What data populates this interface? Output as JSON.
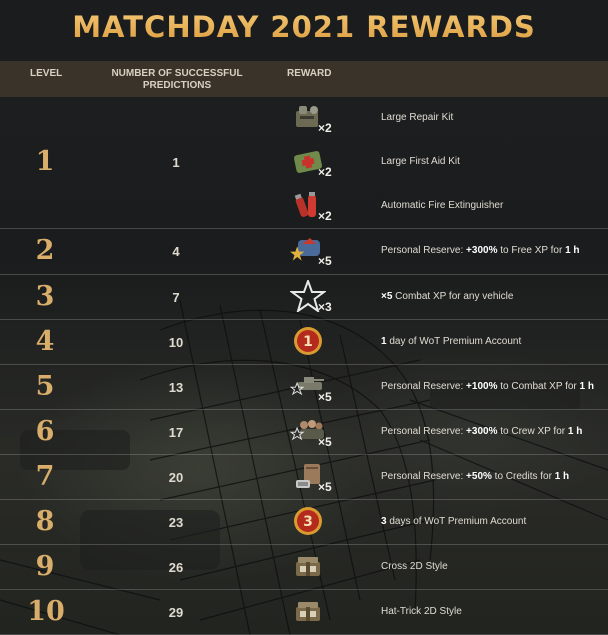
{
  "title": "MATCHDAY 2021 REWARDS",
  "headers": {
    "level": "LEVEL",
    "predictions": "NUMBER OF SUCCESSFUL PREDICTIONS",
    "reward": "REWARD"
  },
  "rows": [
    {
      "level": "1",
      "predictions": "1",
      "items": [
        {
          "icon": "repair-kit-icon",
          "multiplier": "×2",
          "text": [
            [
              "Large Repair Kit",
              false
            ]
          ]
        },
        {
          "icon": "first-aid-kit-icon",
          "multiplier": "×2",
          "text": [
            [
              "Large First Aid Kit",
              false
            ]
          ]
        },
        {
          "icon": "fire-extinguisher-icon",
          "multiplier": "×2",
          "text": [
            [
              "Automatic Fire Extinguisher",
              false
            ]
          ]
        }
      ]
    },
    {
      "level": "2",
      "predictions": "4",
      "items": [
        {
          "icon": "free-xp-reserve-icon",
          "multiplier": "×5",
          "text": [
            [
              "Personal Reserve: ",
              false
            ],
            [
              "+300%",
              true
            ],
            [
              " to Free XP for ",
              false
            ],
            [
              "1 h",
              true
            ]
          ]
        }
      ]
    },
    {
      "level": "3",
      "predictions": "7",
      "items": [
        {
          "icon": "star-icon",
          "multiplier": "×3",
          "text": [
            [
              "×5",
              true
            ],
            [
              " Combat XP for any vehicle",
              false
            ]
          ]
        }
      ]
    },
    {
      "level": "4",
      "predictions": "10",
      "items": [
        {
          "icon": "premium-day-1-icon",
          "multiplier": "",
          "text": [
            [
              "1",
              true
            ],
            [
              " day of WoT Premium Account",
              false
            ]
          ]
        }
      ]
    },
    {
      "level": "5",
      "predictions": "13",
      "items": [
        {
          "icon": "combat-xp-reserve-icon",
          "multiplier": "×5",
          "text": [
            [
              "Personal Reserve: ",
              false
            ],
            [
              "+100%",
              true
            ],
            [
              " to Combat XP for ",
              false
            ],
            [
              "1 h",
              true
            ]
          ]
        }
      ]
    },
    {
      "level": "6",
      "predictions": "17",
      "items": [
        {
          "icon": "crew-xp-reserve-icon",
          "multiplier": "×5",
          "text": [
            [
              "Personal Reserve: ",
              false
            ],
            [
              "+300%",
              true
            ],
            [
              " to Crew XP for ",
              false
            ],
            [
              "1 h",
              true
            ]
          ]
        }
      ]
    },
    {
      "level": "7",
      "predictions": "20",
      "items": [
        {
          "icon": "credits-reserve-icon",
          "multiplier": "×5",
          "text": [
            [
              "Personal Reserve: ",
              false
            ],
            [
              "+50%",
              true
            ],
            [
              " to Credits for ",
              false
            ],
            [
              "1 h",
              true
            ]
          ]
        }
      ]
    },
    {
      "level": "8",
      "predictions": "23",
      "items": [
        {
          "icon": "premium-day-3-icon",
          "multiplier": "",
          "text": [
            [
              "3",
              true
            ],
            [
              " days of WoT Premium Account",
              false
            ]
          ]
        }
      ]
    },
    {
      "level": "9",
      "predictions": "26",
      "items": [
        {
          "icon": "style-crate-icon",
          "multiplier": "",
          "text": [
            [
              "Cross 2D Style",
              false
            ]
          ]
        }
      ]
    },
    {
      "level": "10",
      "predictions": "29",
      "items": [
        {
          "icon": "style-crate-icon",
          "multiplier": "",
          "text": [
            [
              "Hat-Trick 2D Style",
              false
            ]
          ]
        }
      ]
    }
  ],
  "colors": {
    "title_gold": "#e9b25a",
    "level_gold": "#d9ad6a",
    "header_bg": "#3a332a",
    "premium_red": "#b42a1c"
  }
}
